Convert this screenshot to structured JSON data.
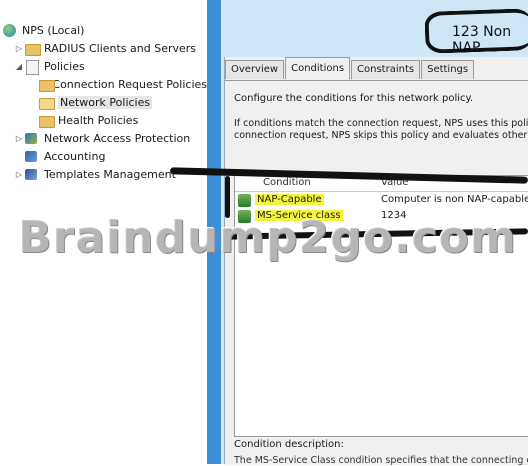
{
  "tree": {
    "items": [
      {
        "label": "NPS (Local)",
        "icon": "server-icon",
        "arrow": ""
      },
      {
        "label": "RADIUS Clients and Servers",
        "icon": "folder-icon",
        "arrow": "▷"
      },
      {
        "label": "Policies",
        "icon": "policy-icon",
        "arrow": "◢"
      },
      {
        "label": "Connection Request Policies",
        "icon": "folder-icon",
        "arrow": ""
      },
      {
        "label": "Network Policies",
        "icon": "folder-icon",
        "arrow": ""
      },
      {
        "label": "Health Policies",
        "icon": "folder-icon",
        "arrow": ""
      },
      {
        "label": "Network Access Protection",
        "icon": "nap-icon",
        "arrow": "▷"
      },
      {
        "label": "Accounting",
        "icon": "accounting-icon",
        "arrow": ""
      },
      {
        "label": "Templates Management",
        "icon": "templates-icon",
        "arrow": "▷"
      }
    ]
  },
  "window_title": "123 Non NAP",
  "tabs": [
    {
      "label": "Overview"
    },
    {
      "label": "Conditions"
    },
    {
      "label": "Constraints"
    },
    {
      "label": "Settings"
    }
  ],
  "panel": {
    "intro": "Configure the conditions for this network policy.",
    "detail_line1": "If conditions match the connection request, NPS uses this policy",
    "detail_line2": "connection request, NPS skips this policy and evaluates other p"
  },
  "grid": {
    "columns": [
      "Condition",
      "Value"
    ],
    "rows": [
      {
        "condition": "NAP-Capable",
        "value": "Computer is non NAP-capable"
      },
      {
        "condition": "MS-Service class",
        "value": "1234"
      }
    ]
  },
  "condition_description": {
    "label": "Condition description:",
    "text": "The MS-Service Class condition specifies that the connecting c"
  },
  "watermark": "Braindump2go.com"
}
